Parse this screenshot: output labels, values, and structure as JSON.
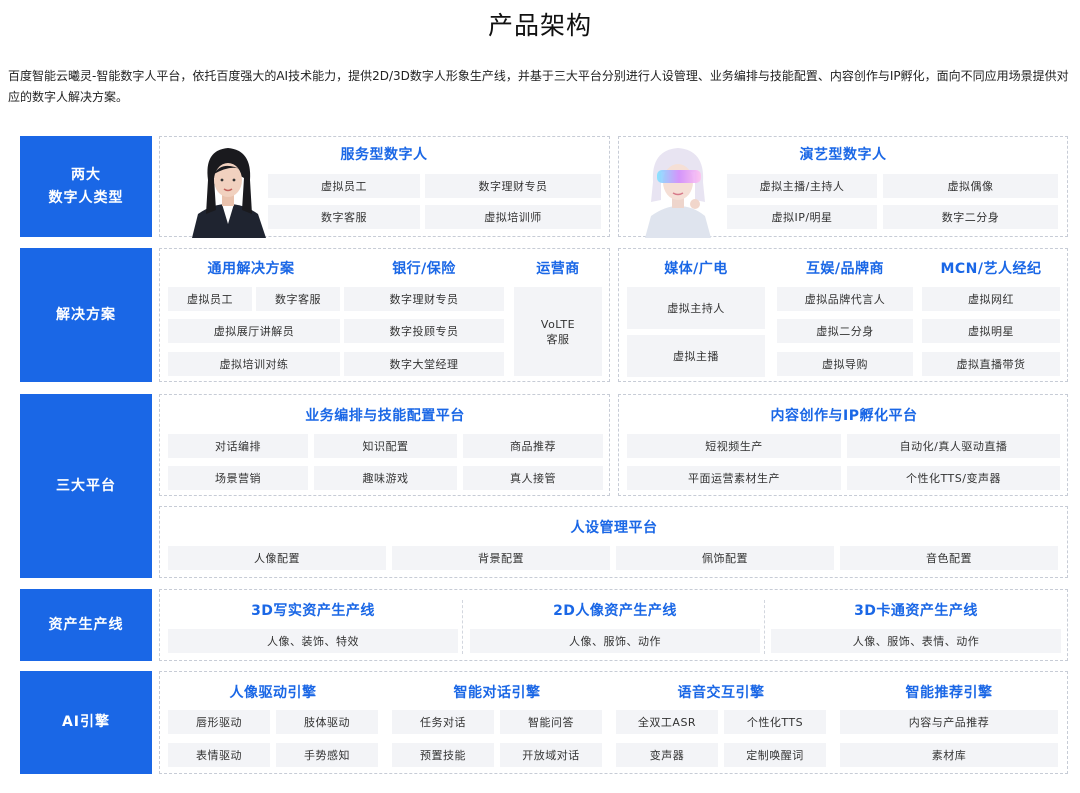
{
  "title": "产品架构",
  "intro": "百度智能云曦灵-智能数字人平台，依托百度强大的AI技术能力，提供2D/3D数字人形象生产线，并基于三大平台分别进行人设管理、业务编排与技能配置、内容创作与IP孵化，面向不同应用场景提供对应的数字人解决方案。",
  "rows": {
    "types": {
      "label_line1": "两大",
      "label_line2": "数字人类型",
      "service": {
        "title": "服务型数字人",
        "items": [
          "虚拟员工",
          "数字理财专员",
          "数字客服",
          "虚拟培训师"
        ]
      },
      "performance": {
        "title": "演艺型数字人",
        "items": [
          "虚拟主播/主持人",
          "虚拟偶像",
          "虚拟IP/明星",
          "数字二分身"
        ]
      }
    },
    "solutions": {
      "label": "解决方案",
      "general": {
        "title": "通用解决方案",
        "items": [
          "虚拟员工",
          "数字客服",
          "虚拟展厅讲解员",
          "虚拟培训对练"
        ]
      },
      "bank": {
        "title": "银行/保险",
        "items": [
          "数字理财专员",
          "数字投顾专员",
          "数字大堂经理"
        ]
      },
      "operator": {
        "title": "运营商",
        "line1": "VoLTE",
        "line2": "客服"
      },
      "media": {
        "title": "媒体/广电",
        "items": [
          "虚拟主持人",
          "虚拟主播"
        ]
      },
      "ent": {
        "title": "互娱/品牌商",
        "items": [
          "虚拟品牌代言人",
          "虚拟二分身",
          "虚拟导购"
        ]
      },
      "mcn": {
        "title": "MCN/艺人经纪",
        "items": [
          "虚拟网红",
          "虚拟明星",
          "虚拟直播带货"
        ]
      }
    },
    "platforms": {
      "label": "三大平台",
      "business": {
        "title": "业务编排与技能配置平台",
        "items": [
          "对话编排",
          "知识配置",
          "商品推荐",
          "场景营销",
          "趣味游戏",
          "真人接管"
        ]
      },
      "content": {
        "title": "内容创作与IP孵化平台",
        "items": [
          "短视频生产",
          "自动化/真人驱动直播",
          "平面运营素材生产",
          "个性化TTS/变声器"
        ]
      },
      "persona": {
        "title": "人设管理平台",
        "items": [
          "人像配置",
          "背景配置",
          "佩饰配置",
          "音色配置"
        ]
      }
    },
    "assets": {
      "label": "资产生产线",
      "lines": [
        {
          "title": "3D写实资产生产线",
          "desc": "人像、装饰、特效"
        },
        {
          "title": "2D人像资产生产线",
          "desc": "人像、服饰、动作"
        },
        {
          "title": "3D卡通资产生产线",
          "desc": "人像、服饰、表情、动作"
        }
      ]
    },
    "ai": {
      "label": "AI引擎",
      "engines": [
        {
          "title": "人像驱动引擎",
          "items": [
            "唇形驱动",
            "肢体驱动",
            "表情驱动",
            "手势感知"
          ]
        },
        {
          "title": "智能对话引擎",
          "items": [
            "任务对话",
            "智能问答",
            "预置技能",
            "开放域对话"
          ]
        },
        {
          "title": "语音交互引擎",
          "items": [
            "全双工ASR",
            "个性化TTS",
            "变声器",
            "定制唤醒词"
          ]
        },
        {
          "title": "智能推荐引擎",
          "items": [
            "内容与产品推荐",
            "素材库"
          ]
        }
      ]
    }
  },
  "colors": {
    "accent": "#1a67e6",
    "pill_bg": "#f3f4f7",
    "border": "#c7ccd6"
  }
}
